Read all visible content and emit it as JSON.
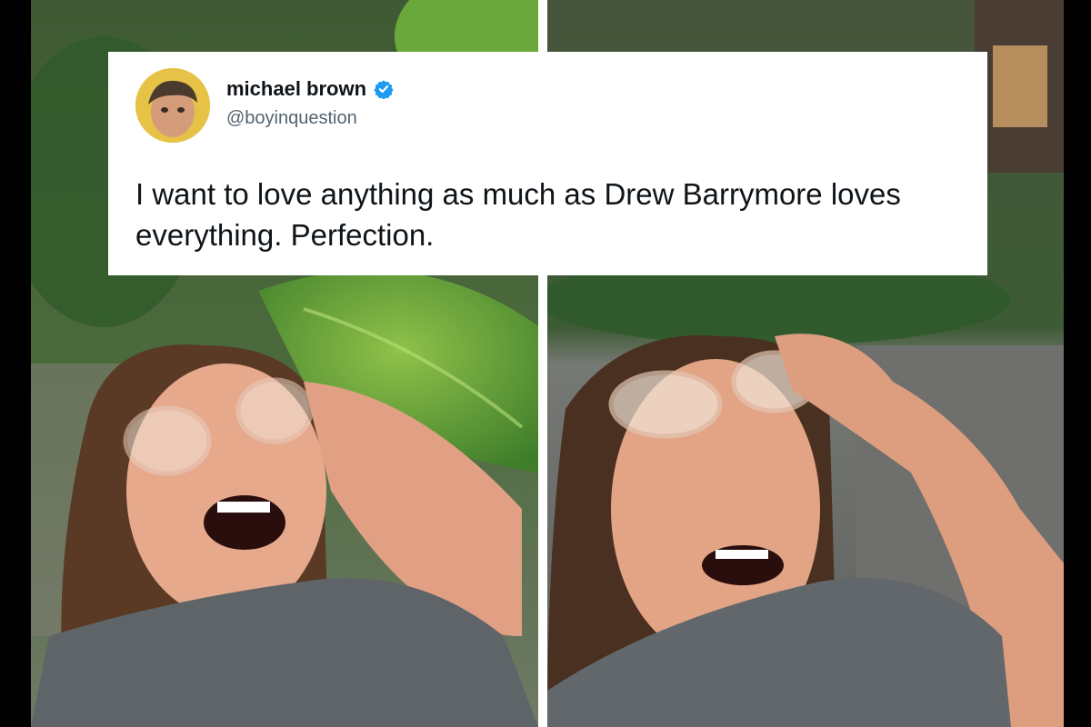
{
  "tweet": {
    "display_name": "michael brown",
    "handle": "@boyinquestion",
    "verified": true,
    "text": "I want to love anything as much as Drew Barrymore loves everything. Perfection.",
    "icons": {
      "verified": "verified-badge-icon",
      "avatar": "profile-avatar"
    },
    "colors": {
      "verified_badge": "#1d9bf0",
      "name": "#0f1419",
      "handle": "#536471"
    }
  }
}
